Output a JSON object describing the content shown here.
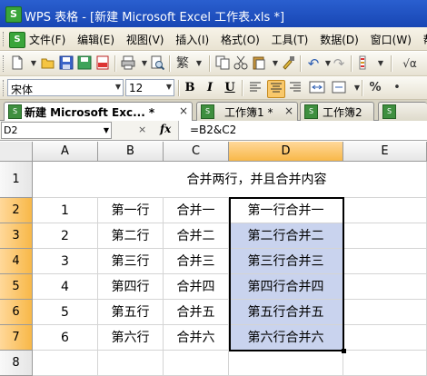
{
  "window": {
    "app_icon": "S",
    "title": "WPS 表格 - [新建 Microsoft Excel 工作表.xls *]"
  },
  "menubar": {
    "icon": "S",
    "items": [
      "文件(F)",
      "编辑(E)",
      "视图(V)",
      "插入(I)",
      "格式(O)",
      "工具(T)",
      "数据(D)",
      "窗口(W)",
      "帮助"
    ]
  },
  "toolbar": {
    "icons": [
      "new-icon",
      "open-icon",
      "save-icon",
      "save-as-icon",
      "pdf-icon",
      "print-icon",
      "print-preview-icon",
      "traditional-chinese-icon",
      "copy-icon",
      "cut-icon",
      "paste-icon",
      "format-painter-icon",
      "undo-icon",
      "redo-icon",
      "sort-icon",
      "sum-icon"
    ],
    "traditional_label": "繁",
    "sum_label": "√α"
  },
  "format_toolbar": {
    "font_name": "宋体",
    "font_size": "12",
    "bold": "B",
    "italic": "I",
    "underline": "U",
    "percent": "%",
    "comma": "•"
  },
  "tabs": [
    {
      "label": "新建 Microsoft Exc... *",
      "close": "×",
      "active": true
    },
    {
      "label": "工作簿1 *",
      "close": "×",
      "active": false
    },
    {
      "label": "工作簿2",
      "close": "",
      "active": false
    },
    {
      "label": "",
      "close": "",
      "active": false
    }
  ],
  "formula_bar": {
    "name_box": "D2",
    "cancel": "×",
    "fx": "fx",
    "formula": "=B2&C2"
  },
  "sheet": {
    "columns": [
      "A",
      "B",
      "C",
      "D",
      "E"
    ],
    "selected_column": "D",
    "rows": [
      "1",
      "2",
      "3",
      "4",
      "5",
      "6",
      "7",
      "8"
    ],
    "selected_rows": [
      "2",
      "3",
      "4",
      "5",
      "6",
      "7"
    ],
    "title_cell": "合并两行，并且合并内容",
    "data": [
      {
        "a": "1",
        "b": "第一行",
        "c": "合并一",
        "d": "第一行合并一"
      },
      {
        "a": "2",
        "b": "第二行",
        "c": "合并二",
        "d": "第二行合并二"
      },
      {
        "a": "3",
        "b": "第三行",
        "c": "合并三",
        "d": "第三行合并三"
      },
      {
        "a": "4",
        "b": "第四行",
        "c": "合并四",
        "d": "第四行合并四"
      },
      {
        "a": "5",
        "b": "第五行",
        "c": "合并五",
        "d": "第五行合并五"
      },
      {
        "a": "6",
        "b": "第六行",
        "c": "合并六",
        "d": "第六行合并六"
      }
    ]
  },
  "colors": {
    "title_bar": "#2153c4",
    "selection_fill": "#c9d3ee",
    "header_selected": "#f8b848"
  }
}
